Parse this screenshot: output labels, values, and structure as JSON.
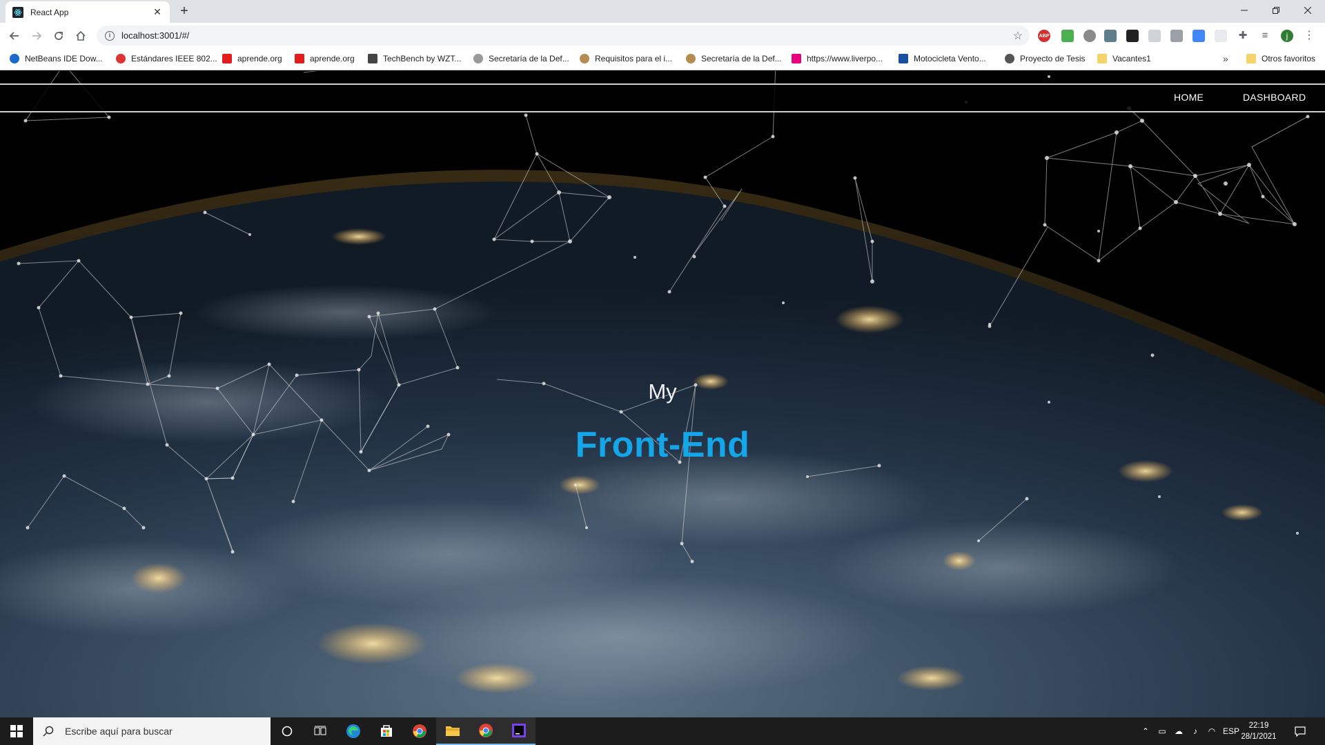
{
  "browser": {
    "tab_title": "React App",
    "url": "localhost:3001/#/",
    "bookmarks": [
      {
        "label": "NetBeans IDE Dow...",
        "icon": "netbeans-icon",
        "color": "#1b6ac9"
      },
      {
        "label": "Estándares IEEE 802...",
        "icon": "ieee-icon",
        "color": "#d33"
      },
      {
        "label": "aprende.org",
        "icon": "aprende-icon",
        "color": "#e21b1b"
      },
      {
        "label": "aprende.org",
        "icon": "aprende-icon",
        "color": "#e21b1b"
      },
      {
        "label": "TechBench by WZT...",
        "icon": "techbench-icon",
        "color": "#444"
      },
      {
        "label": "Secretaría de la Def...",
        "icon": "sedena-icon",
        "color": "#999"
      },
      {
        "label": "Requisitos para el i...",
        "icon": "requisitos-icon",
        "color": "#b58b52"
      },
      {
        "label": "Secretaría de la Def...",
        "icon": "sedena-icon",
        "color": "#b58b52"
      },
      {
        "label": "https://www.liverpo...",
        "icon": "liverpool-icon",
        "color": "#e6007e"
      },
      {
        "label": "Motocicleta Vento...",
        "icon": "vento-icon",
        "color": "#1a4fa0"
      },
      {
        "label": "Proyecto de Tesis",
        "icon": "globe-icon",
        "color": "#555"
      },
      {
        "label": "Vacantes1",
        "icon": "folder-icon",
        "color": "#f6d26b"
      }
    ],
    "other_bookmarks": "Otros favoritos",
    "profile_initial": "j"
  },
  "site": {
    "nav": {
      "home": "HOME",
      "dashboard": "DASHBOARD"
    },
    "hero": {
      "line1": "My",
      "line2": "Front-End"
    },
    "accent_color": "#14a6e8"
  },
  "taskbar": {
    "search_placeholder": "Escribe aquí para buscar",
    "language": "ESP",
    "time": "22:19",
    "date": "28/1/2021"
  }
}
